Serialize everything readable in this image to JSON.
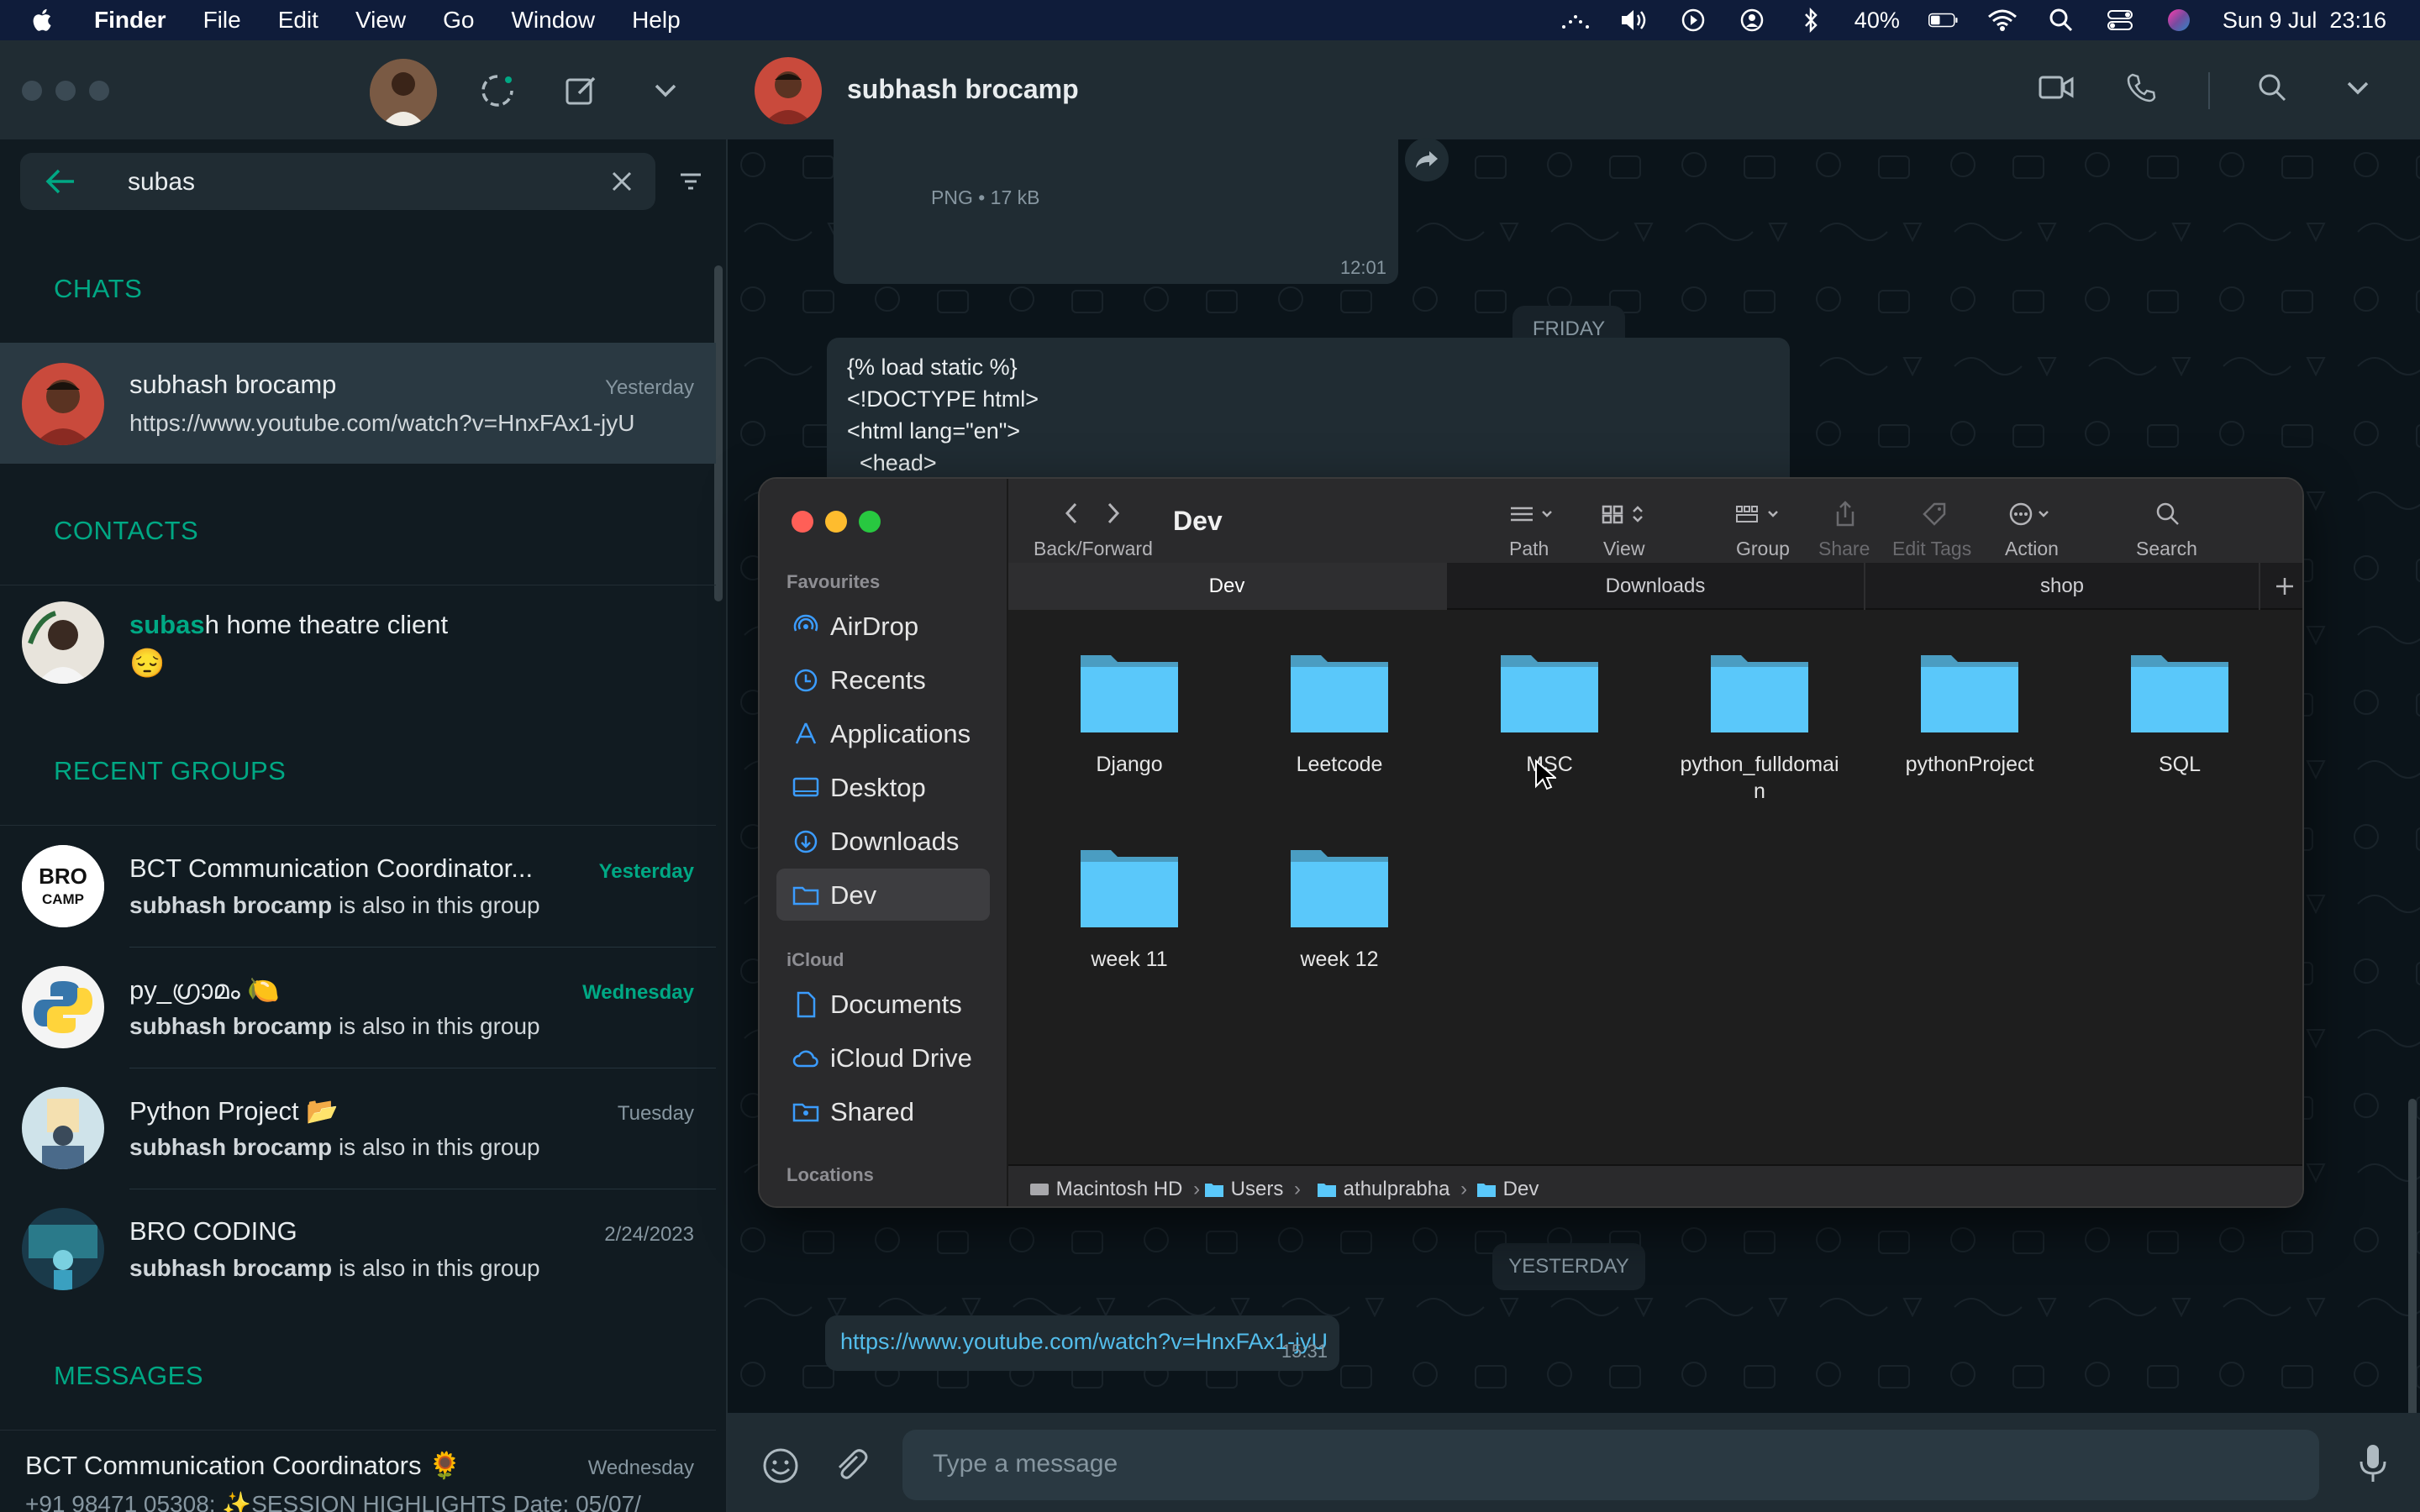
{
  "menubar": {
    "app": "Finder",
    "items": [
      "File",
      "Edit",
      "View",
      "Go",
      "Window",
      "Help"
    ],
    "battery": "40%",
    "datetime": "Sun 9 Jul  23:16"
  },
  "sidebar": {
    "search_value": "subas",
    "sections": {
      "chats": "CHATS",
      "contacts": "CONTACTS",
      "recent_groups": "RECENT GROUPS",
      "messages": "MESSAGES"
    },
    "chats": [
      {
        "name": "subhash brocamp",
        "time": "Yesterday",
        "preview": "https://www.youtube.com/watch?v=HnxFAx1-jyU"
      }
    ],
    "contacts": [
      {
        "name_highlight": "subas",
        "name_rest": "h home theatre client",
        "preview": "😔"
      }
    ],
    "groups": [
      {
        "name": "BCT Communication Coordinator...",
        "time": "Yesterday",
        "member": "subhash brocamp",
        "suffix": " is also in this group",
        "avatar_text": "BRO CAMP"
      },
      {
        "name": "py_ഗ്രാമം 🍋",
        "time": "Wednesday",
        "member": "subhash brocamp",
        "suffix": " is also in this group"
      },
      {
        "name": "Python Project 📂",
        "time": "Tuesday",
        "member": "subhash brocamp",
        "suffix": " is also in this group"
      },
      {
        "name": "BRO CODING",
        "time": "2/24/2023",
        "member": "subhash brocamp",
        "suffix": " is also in this group"
      }
    ],
    "messages": [
      {
        "name": "BCT Communication Coordinators 🌻",
        "time": "Wednesday",
        "preview": "+91 98471 05308: ✨SESSION HIGHLIGHTS Date: 05/07/"
      }
    ]
  },
  "chat": {
    "title": "subhash brocamp",
    "file_meta": "PNG • 17 kB",
    "file_time": "12:01",
    "day1": "FRIDAY",
    "code_lines": [
      "{% load static %}",
      "<!DOCTYPE html>",
      "<html lang=\"en\">",
      "  <head>"
    ],
    "day2": "YESTERDAY",
    "link": "https://www.youtube.com/watch?v=HnxFAx1-jyU",
    "link_time": "15:31",
    "composer_placeholder": "Type a message"
  },
  "finder": {
    "title": "Dev",
    "toolbar": {
      "back_forward": "Back/Forward",
      "path": "Path",
      "view": "View",
      "group": "Group",
      "share": "Share",
      "edit_tags": "Edit Tags",
      "action": "Action",
      "search": "Search"
    },
    "tabs": [
      "Dev",
      "Downloads",
      "shop"
    ],
    "sidebar": {
      "favourites": "Favourites",
      "icloud": "iCloud",
      "locations": "Locations",
      "fav_items": [
        "AirDrop",
        "Recents",
        "Applications",
        "Desktop",
        "Downloads",
        "Dev"
      ],
      "icloud_items": [
        "Documents",
        "iCloud Drive",
        "Shared"
      ]
    },
    "folders": [
      "Django",
      "Leetcode",
      "MSC",
      "python_fulldomain",
      "pythonProject",
      "SQL",
      "week 11",
      "week 12"
    ],
    "path": [
      "Macintosh HD",
      "Users",
      "athulprabha",
      "Dev"
    ],
    "colors": {
      "folder": "#5ac8fa",
      "close": "#ff5f57",
      "minimize": "#febc2e",
      "zoom": "#28c840",
      "accent": "#00a884"
    }
  }
}
